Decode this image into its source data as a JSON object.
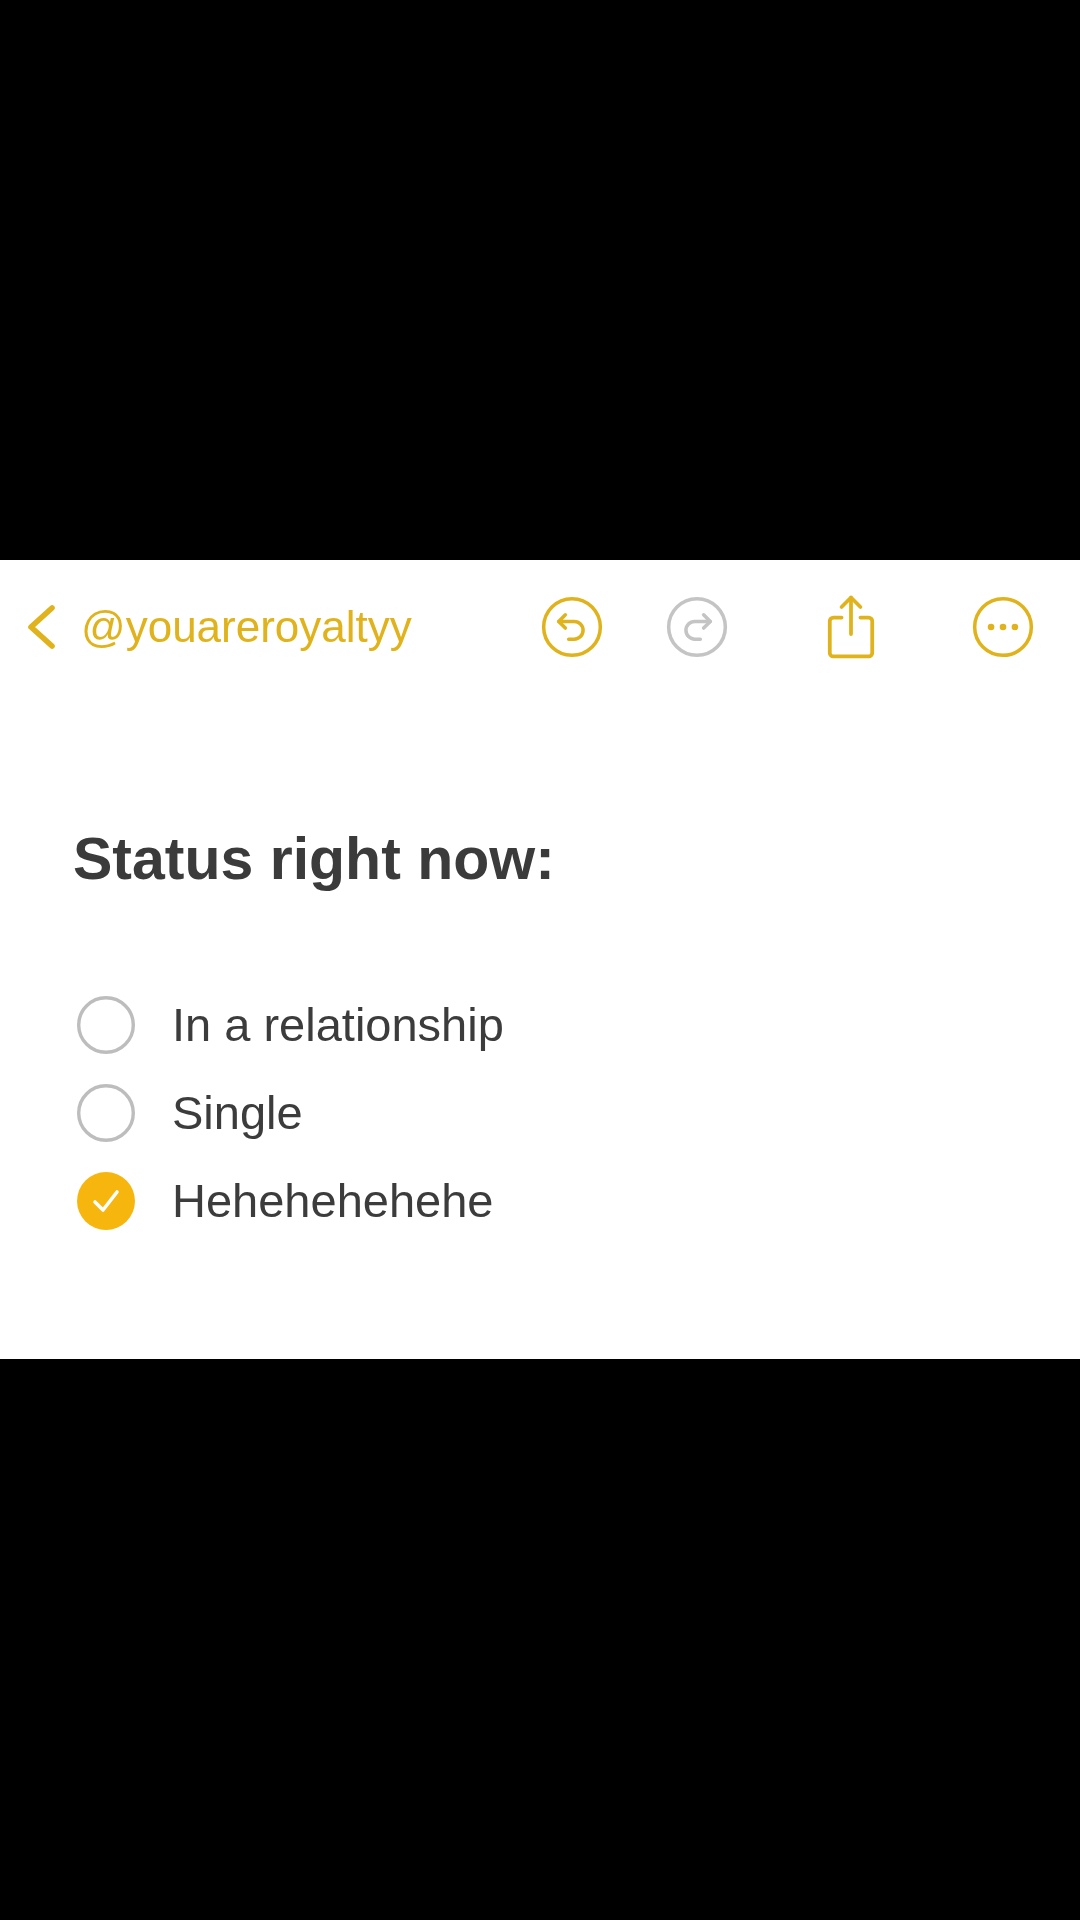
{
  "toolbar": {
    "back_label": "@youareroyaltyy",
    "buttons": [
      {
        "kind": "undo",
        "disabled": false
      },
      {
        "kind": "redo",
        "disabled": true
      },
      {
        "kind": "share",
        "disabled": false
      },
      {
        "kind": "more",
        "disabled": false
      }
    ]
  },
  "note": {
    "title": "Status right now:",
    "checklist": [
      {
        "label": "In a relationship",
        "checked": false
      },
      {
        "label": "Single",
        "checked": false
      },
      {
        "label": "Hehehehehehe",
        "checked": true
      }
    ]
  }
}
